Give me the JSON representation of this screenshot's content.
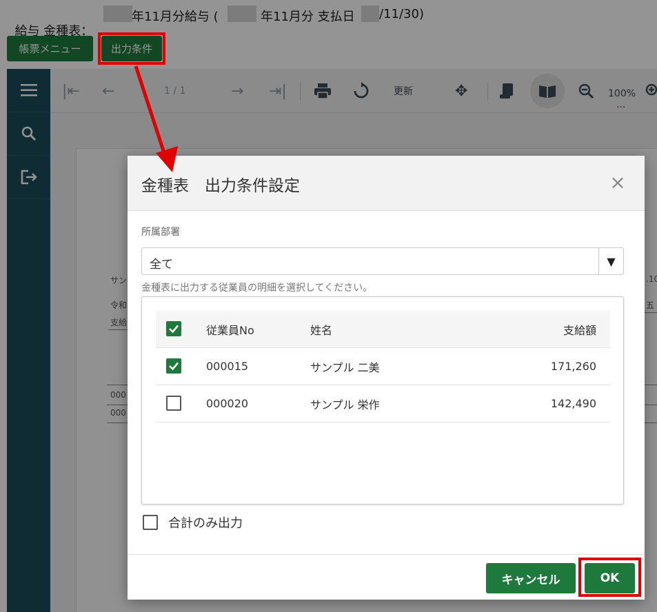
{
  "header": {
    "title_prefix": "給与 金種表：",
    "title_part2": "年11月分給与 (",
    "title_part3": "年11月分 支払日",
    "title_part4": "/11/30)"
  },
  "buttons": {
    "report_menu": "帳票メニュー",
    "output_conditions": "出力条件"
  },
  "toolbar": {
    "page_indicator": "1 / 1",
    "refresh_label": "更新",
    "zoom_level": "100%",
    "zoom_more": "..."
  },
  "background_report": {
    "line1": "サン",
    "line2": "令和",
    "line3": "支給",
    "row1": "000",
    "row2": "000",
    "right1": ".10",
    "right2": "五"
  },
  "modal": {
    "title": "金種表　出力条件設定",
    "close_symbol": "×",
    "dept_label": "所属部署",
    "dept_value": "全て",
    "dept_arrow": "▼",
    "hint": "金種表に出力する従業員の明細を選択してください。",
    "columns": {
      "no": "従業員No",
      "name": "姓名",
      "amount": "支給額"
    },
    "header_checked": true,
    "employees": [
      {
        "no": "000015",
        "name": "サンプル 二美",
        "amount": "171,260",
        "checked": true
      },
      {
        "no": "000020",
        "name": "サンプル 栄作",
        "amount": "142,490",
        "checked": false
      }
    ],
    "total_only_label": "合計のみ出力",
    "total_only_checked": false,
    "cancel_label": "キャンセル",
    "ok_label": "OK"
  },
  "colors": {
    "accent_green": "#1e7a3c",
    "sidebar": "#1b4a5a",
    "highlight_red": "#e00000"
  }
}
